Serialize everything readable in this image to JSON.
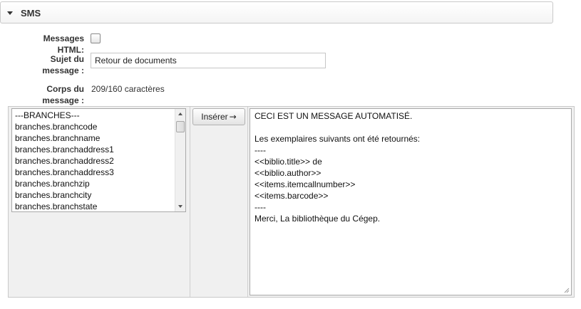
{
  "section": {
    "title": "SMS"
  },
  "form": {
    "html_label": "Messages HTML:",
    "subject_label_1": "Sujet du",
    "subject_label_2": "message :",
    "subject_value": "Retour de documents",
    "body_label_1": "Corps du",
    "body_label_2": "message :",
    "char_count": "209/160 caractères"
  },
  "fields_list": [
    "---BRANCHES---",
    "branches.branchcode",
    "branches.branchname",
    "branches.branchaddress1",
    "branches.branchaddress2",
    "branches.branchaddress3",
    "branches.branchzip",
    "branches.branchcity",
    "branches.branchstate"
  ],
  "insert_button": {
    "label": "Insérer",
    "arrow": "→"
  },
  "message_lines": [
    "CECI EST UN MESSAGE AUTOMATISÉ.",
    "",
    "Les exemplaires suivants ont été retournés:",
    "----",
    "<<biblio.title>> de",
    "<<biblio.author>>",
    "<<items.itemcallnumber>>",
    "<<items.barcode>>",
    "----",
    "Merci, La bibliothèque du Cégep."
  ]
}
